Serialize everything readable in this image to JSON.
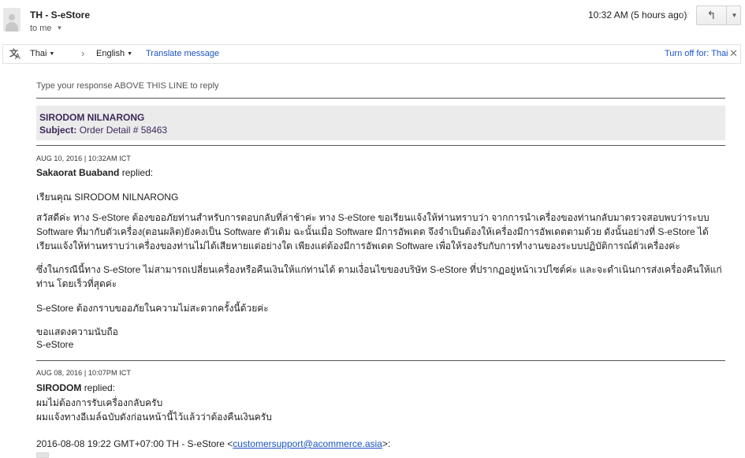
{
  "header": {
    "sender": "TH - S-eStore",
    "recipient": "to me",
    "timestamp": "10:32 AM (5 hours ago)",
    "star_icon": "star-outline-icon",
    "reply_icon": "reply-arrow-icon"
  },
  "translate": {
    "source_lang": "Thai",
    "target_lang": "English",
    "translate_link": "Translate message",
    "turn_off_link": "Turn off for: Thai"
  },
  "message": {
    "hint": "Type your response ABOVE THIS LINE to reply",
    "ticket": {
      "name": "SIRODOM NILNARONG",
      "subject_label": "Subject:",
      "subject_value": "Order Detail # 58463"
    },
    "reply1": {
      "meta": "AUG 10, 2016  |  10:32AM ICT",
      "author": "Sakaorat Buaband",
      "action": "replied:",
      "greeting": "เรียนคุณ SIRODOM NILNARONG",
      "para1": "สวัสดีค่ะ ทาง S-eStore ต้องขออภัยท่านสำหรับการตอบกลับที่ล่าช้าค่ะ ทาง S-eStore ขอเรียนแจ้งให้ท่านทราบว่า จากการนำเครื่องของท่านกลับมาตรวจสอบพบว่าระบบ Software ที่มากับตัวเครื่อง(ตอนผลิต)ยังคงเป็น Software ตัวเดิม ฉะนั้นเมื่อ Software มีการอัพเดต จึงจำเป็นต้องให้เครื่องมีการอัพเดตตามด้วย ดังนั้นอย่างที่ S-eStore ได้เรียนแจ้งให้ท่านทราบว่าเครื่องของท่านไม่ได้เสียหายแต่อย่างใด เพียงแต่ต้องมีการอัพเดต Software เพื่อให้รองรับกับการทำงานของระบบปฏิบัติการณ์ตัวเครื่องค่ะ",
      "para2": "ซึ่งในกรณีนี้ทาง S-eStore ไม่สามารถเปลี่ยนเครื่องหรือคืนเงินให้แก่ท่านได้ ตามเงื่อนไขของบริษัท S-eStore ที่ปรากฏอยู่หน้าเวปไซต์ค่ะ และจะดำเนินการส่งเครื่องคืนให้แก่ท่าน โดยเร็วที่สุดค่ะ",
      "para3": "S-eStore ต้องกราบขออภัยในความไม่สะดวกครั้งนี้ด้วยค่ะ",
      "closing": "ขอแสดงความนับถือ",
      "signature": "S-eStore"
    },
    "reply2": {
      "meta": "AUG 08, 2016  |  10:07PM ICT",
      "author": "SIRODOM",
      "action": "replied:",
      "line1": "ผมไม่ต้องการรับเครื่องกลับครับ",
      "line2": "ผมแจ้งทางอีเมล์ฉบับดังก่อนหน้านี้ไว้แล้วว่าต้องคืนเงินครับ"
    },
    "quote": {
      "prefix": "2016-08-08 19:22 GMT+07:00 TH - S-eStore <",
      "email": "customersupport@acommerce.asia",
      "suffix": ">:"
    }
  }
}
